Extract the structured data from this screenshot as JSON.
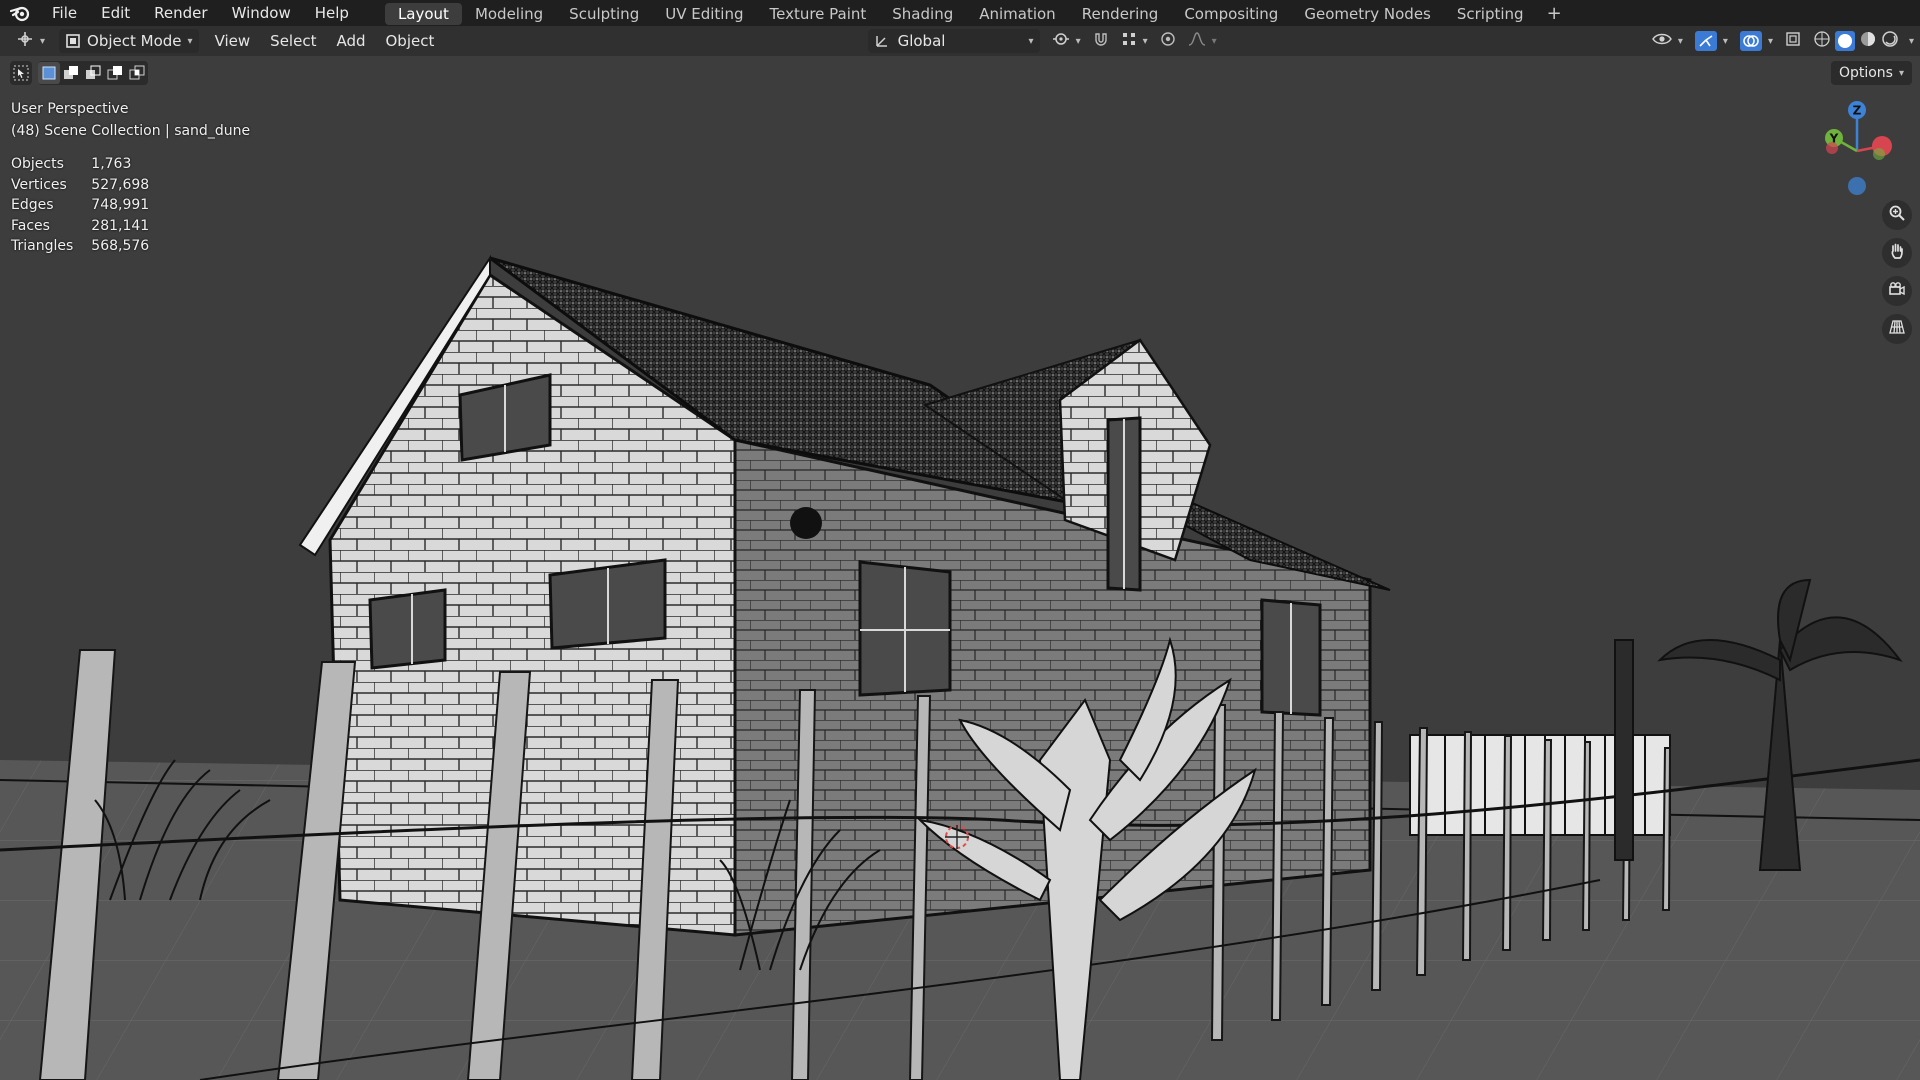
{
  "topbar": {
    "menus": [
      "File",
      "Edit",
      "Render",
      "Window",
      "Help"
    ],
    "workspaces": [
      {
        "label": "Layout",
        "active": true
      },
      {
        "label": "Modeling",
        "active": false
      },
      {
        "label": "Sculpting",
        "active": false
      },
      {
        "label": "UV Editing",
        "active": false
      },
      {
        "label": "Texture Paint",
        "active": false
      },
      {
        "label": "Shading",
        "active": false
      },
      {
        "label": "Animation",
        "active": false
      },
      {
        "label": "Rendering",
        "active": false
      },
      {
        "label": "Compositing",
        "active": false
      },
      {
        "label": "Geometry Nodes",
        "active": false
      },
      {
        "label": "Scripting",
        "active": false
      }
    ],
    "add_workspace": "+"
  },
  "header": {
    "mode": "Object Mode",
    "menus": [
      "View",
      "Select",
      "Add",
      "Object"
    ],
    "orientation": "Global"
  },
  "options_label": "Options",
  "viewport": {
    "view_name": "User Perspective",
    "collection_line": "(48) Scene Collection | sand_dune",
    "stats": [
      {
        "label": "Objects",
        "value": "1,763"
      },
      {
        "label": "Vertices",
        "value": "527,698"
      },
      {
        "label": "Edges",
        "value": "748,991"
      },
      {
        "label": "Faces",
        "value": "281,141"
      },
      {
        "label": "Triangles",
        "value": "568,576"
      }
    ],
    "gizmo_labels": {
      "z": "Z",
      "y": "Y"
    }
  },
  "colors": {
    "axis_x": "#d64550",
    "axis_y": "#6fb33d",
    "axis_z": "#3d82d6",
    "active_blue": "#3b7bd5",
    "background": "#3d3d3d"
  }
}
